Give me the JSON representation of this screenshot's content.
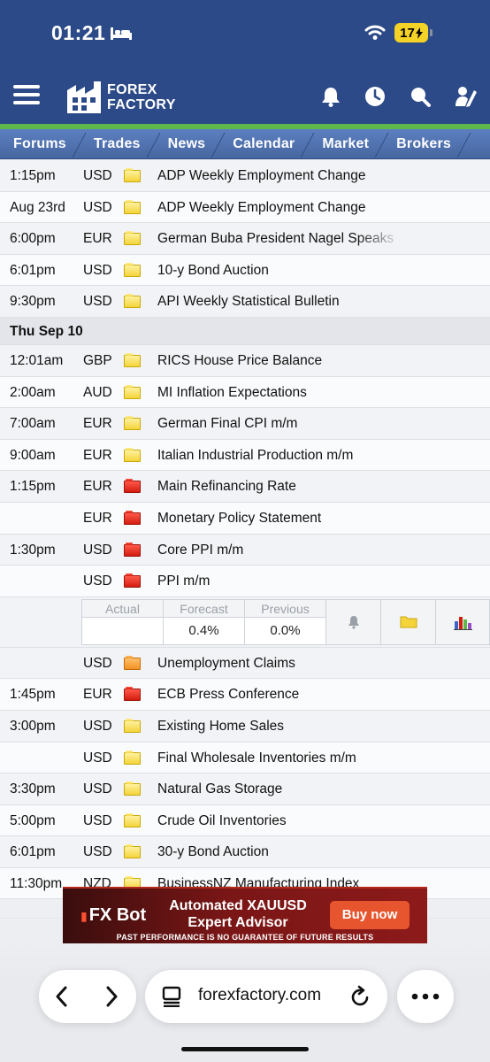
{
  "status": {
    "time": "01:21",
    "battery": "17"
  },
  "header": {
    "logo_line1": "FOREX",
    "logo_line2": "FACTORY"
  },
  "nav": [
    "Forums",
    "Trades",
    "News",
    "Calendar",
    "Market",
    "Brokers"
  ],
  "colors": {
    "header_bg": "#2c4a88",
    "accent_green": "#5fb84a",
    "impact_low": "#f4d43a",
    "impact_medium": "#f29324",
    "impact_high": "#d31d10"
  },
  "calendar": {
    "rows1": [
      {
        "time": "1:15pm",
        "currency": "USD",
        "impact": "low",
        "event": "ADP Weekly Employment Change"
      },
      {
        "time": "Aug 23rd",
        "currency": "USD",
        "impact": "low",
        "event": "ADP Weekly Employment Change"
      },
      {
        "time": "6:00pm",
        "currency": "EUR",
        "impact": "low",
        "event": "German Buba President Nagel Speaks"
      },
      {
        "time": "6:01pm",
        "currency": "USD",
        "impact": "low",
        "event": "10-y Bond Auction"
      },
      {
        "time": "9:30pm",
        "currency": "USD",
        "impact": "low",
        "event": "API Weekly Statistical Bulletin"
      }
    ],
    "day_header": "Thu Sep 10",
    "rows2": [
      {
        "time": "12:01am",
        "currency": "GBP",
        "impact": "low",
        "event": "RICS House Price Balance"
      },
      {
        "time": "2:00am",
        "currency": "AUD",
        "impact": "low",
        "event": "MI Inflation Expectations"
      },
      {
        "time": "7:00am",
        "currency": "EUR",
        "impact": "low",
        "event": "German Final CPI m/m"
      },
      {
        "time": "9:00am",
        "currency": "EUR",
        "impact": "low",
        "event": "Italian Industrial Production m/m"
      },
      {
        "time": "1:15pm",
        "currency": "EUR",
        "impact": "high",
        "event": "Main Refinancing Rate"
      },
      {
        "time": "",
        "currency": "EUR",
        "impact": "high",
        "event": "Monetary Policy Statement"
      },
      {
        "time": "1:30pm",
        "currency": "USD",
        "impact": "high",
        "event": "Core PPI m/m"
      },
      {
        "time": "",
        "currency": "USD",
        "impact": "high",
        "event": "PPI m/m"
      }
    ],
    "detail": {
      "actual_label": "Actual",
      "forecast_label": "Forecast",
      "previous_label": "Previous",
      "actual": "",
      "forecast": "0.4%",
      "previous": "0.0%"
    },
    "rows3": [
      {
        "time": "",
        "currency": "USD",
        "impact": "medium",
        "event": "Unemployment Claims"
      },
      {
        "time": "1:45pm",
        "currency": "EUR",
        "impact": "high",
        "event": "ECB Press Conference"
      },
      {
        "time": "3:00pm",
        "currency": "USD",
        "impact": "low",
        "event": "Existing Home Sales"
      },
      {
        "time": "",
        "currency": "USD",
        "impact": "low",
        "event": "Final Wholesale Inventories m/m"
      },
      {
        "time": "3:30pm",
        "currency": "USD",
        "impact": "low",
        "event": "Natural Gas Storage"
      },
      {
        "time": "5:00pm",
        "currency": "USD",
        "impact": "low",
        "event": "Crude Oil Inventories"
      },
      {
        "time": "6:01pm",
        "currency": "USD",
        "impact": "low",
        "event": "30-y Bond Auction"
      },
      {
        "time": "11:30pm",
        "currency": "NZD",
        "impact": "low",
        "event": "BusinessNZ Manufacturing Index"
      }
    ]
  },
  "ad": {
    "brand": "FX Bot",
    "title": "Automated XAUUSD Expert Advisor",
    "button": "Buy now",
    "disclaimer": "PAST PERFORMANCE IS NO GUARANTEE OF FUTURE RESULTS"
  },
  "browser": {
    "url": "forexfactory.com"
  }
}
